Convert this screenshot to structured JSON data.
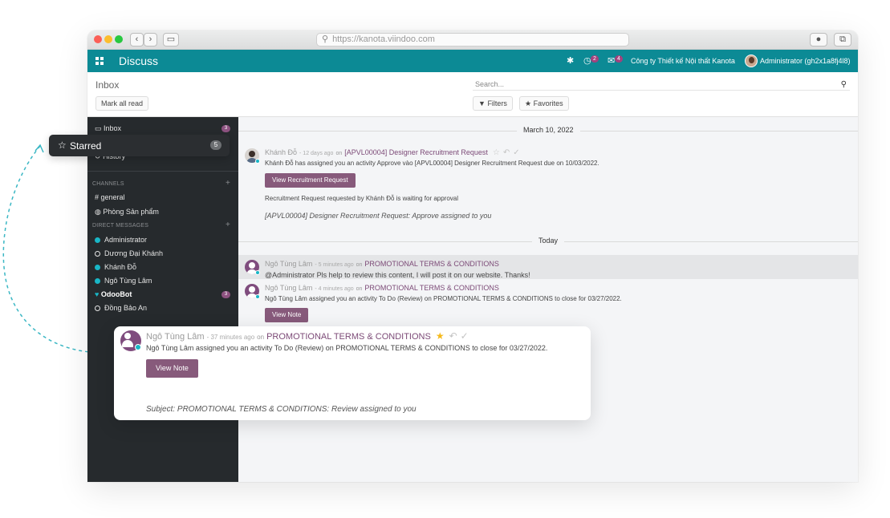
{
  "browser": {
    "url": "https://kanota.viindoo.com",
    "back_icon": "chevron-left-icon",
    "forward_icon": "chevron-right-icon"
  },
  "topbar": {
    "app_name": "Discuss",
    "activity_count": "2",
    "message_count": "4",
    "company": "Công ty Thiết kế Nội thất Kanota",
    "user": "Administrator (gh2x1a8fj4l8)"
  },
  "control_panel": {
    "title": "Inbox",
    "mark_all_read": "Mark all read",
    "search_placeholder": "Search...",
    "filters": "Filters",
    "favorites": "Favorites"
  },
  "sidebar": {
    "inbox": {
      "label": "Inbox",
      "count": "3"
    },
    "history": {
      "label": "History"
    },
    "channels_header": "CHANNELS",
    "channels": [
      "general",
      "Phòng Sản phẩm"
    ],
    "dm_header": "DIRECT MESSAGES",
    "dms": [
      "Administrator",
      "Dương Đại Khánh",
      "Khánh Đỗ",
      "Ngô Tùng Lâm",
      "OdooBot",
      "Đồng Bảo An"
    ],
    "odoobot_count": "3"
  },
  "starred": {
    "label": "Starred",
    "count": "5"
  },
  "thread": {
    "date1": "March 10, 2022",
    "date2": "Today",
    "msg1": {
      "author": "Khánh Đỗ",
      "ago": "- 12 days ago",
      "on": "on",
      "record": "[APVL00004] Designer Recruitment Request",
      "body": "Khánh Đỗ has assigned you an activity Approve vào [APVL00004] Designer Recruitment Request due on 10/03/2022.",
      "button": "View Recruitment Request",
      "note": "Recruitment Request requested by Khánh Đỗ is waiting for approval",
      "subject": "[APVL00004] Designer Recruitment Request: Approve assigned to you"
    },
    "msg2": {
      "author": "Ngô Tùng Lâm",
      "ago": "- 5 minutes ago",
      "on": "on",
      "record": "PROMOTIONAL TERMS & CONDITIONS",
      "body": "@Administrator Pls help to review this content, I will post it on our website. Thanks!"
    },
    "msg3": {
      "author": "Ngô Tùng Lâm",
      "ago": "- 4 minutes ago",
      "on": "on",
      "record": "PROMOTIONAL TERMS & CONDITIONS",
      "body": "Ngô Tùng Lâm assigned you an activity To Do (Review) on PROMOTIONAL TERMS & CONDITIONS to close for 03/27/2022.",
      "button": "View Note"
    }
  },
  "zoom": {
    "author": "Ngô Tùng Lâm",
    "ago": "- 37 minutes ago",
    "on": "on",
    "record": "PROMOTIONAL TERMS & CONDITIONS",
    "body": "Ngô Tùng Lâm assigned you an activity To Do (Review) on PROMOTIONAL TERMS & CONDITIONS to close for 03/27/2022.",
    "button": "View Note",
    "subject": "Subject: PROMOTIONAL TERMS & CONDITIONS: Review assigned to you"
  },
  "colors": {
    "brand": "#0c8a95",
    "accent": "#875a7b",
    "sidebar": "#262a2d",
    "online": "#19b6c6",
    "star": "#f5b91b"
  }
}
